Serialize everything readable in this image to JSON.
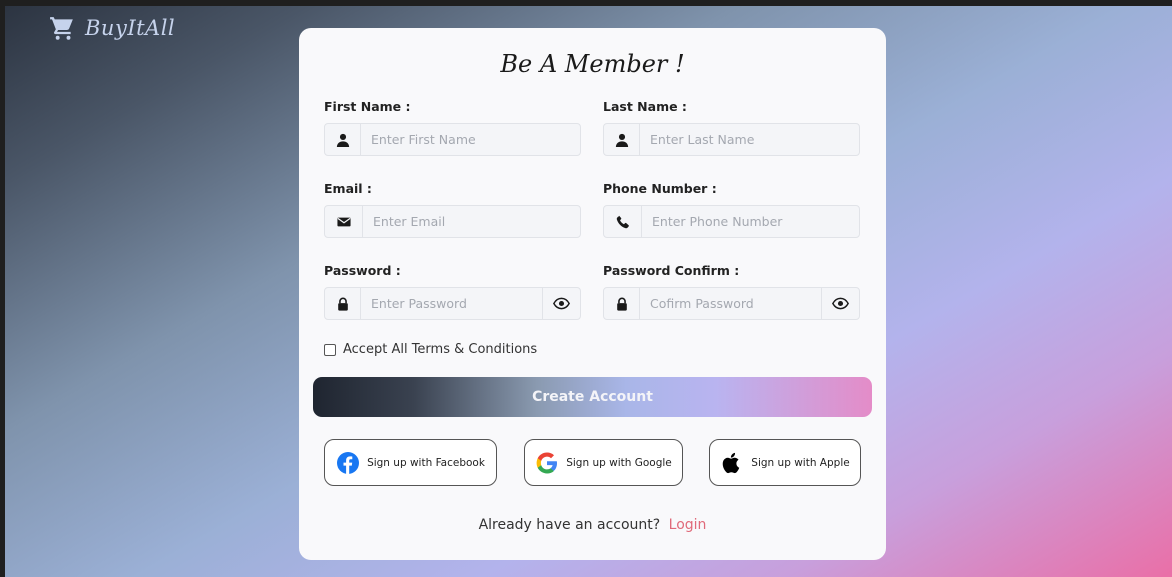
{
  "brand": {
    "name": "BuyItAll",
    "icon": "cart-icon"
  },
  "form": {
    "title": "Be A Member !",
    "first_name": {
      "label": "First Name :",
      "placeholder": "Enter First Name",
      "icon": "user-icon"
    },
    "last_name": {
      "label": "Last Name :",
      "placeholder": "Enter Last Name",
      "icon": "user-icon"
    },
    "email": {
      "label": "Email :",
      "placeholder": "Enter Email",
      "icon": "envelope-icon"
    },
    "phone": {
      "label": "Phone Number :",
      "placeholder": "Enter Phone Number",
      "icon": "phone-icon"
    },
    "password": {
      "label": "Password :",
      "placeholder": "Enter Password",
      "icon": "lock-icon"
    },
    "password_confirm": {
      "label": "Password Confirm :",
      "placeholder": "Cofirm Password",
      "icon": "lock-icon"
    },
    "terms_label": "Accept All Terms & Conditions",
    "submit_label": "Create Account"
  },
  "social": {
    "facebook_label": "Sign up with Facebook",
    "google_label": "Sign up with Google",
    "apple_label": "Sign up with Apple"
  },
  "login": {
    "prompt": "Already have an account?",
    "link_label": "Login"
  },
  "colors": {
    "link": "#e06a7a",
    "facebook": "#1877f2",
    "card_bg": "#f9f9fb"
  }
}
